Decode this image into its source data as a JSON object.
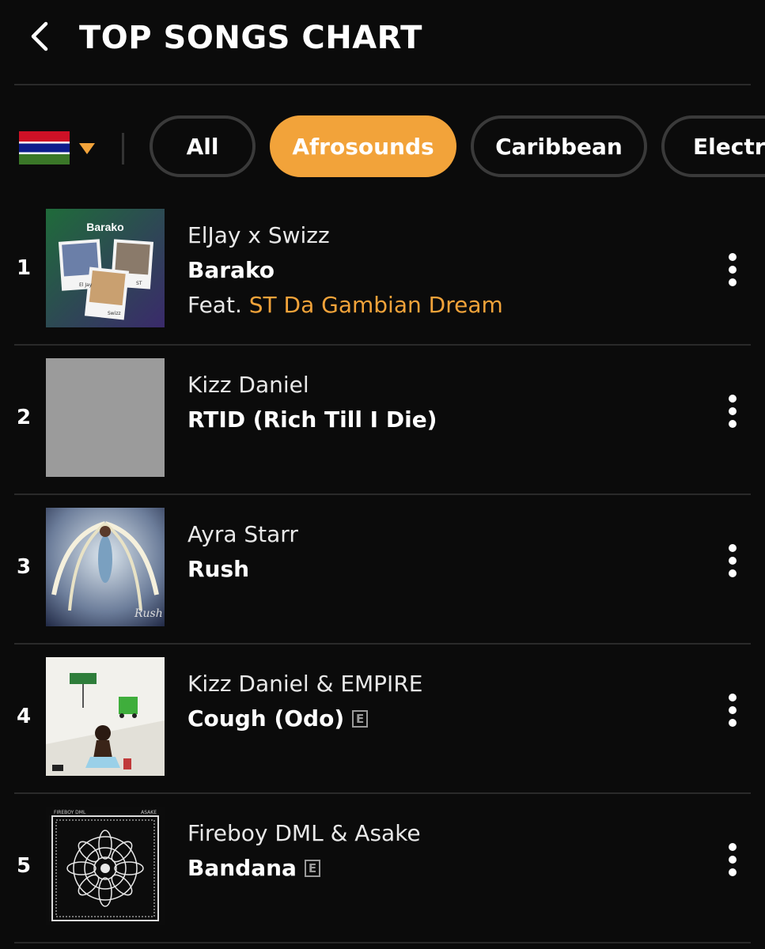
{
  "header": {
    "title": "TOP SONGS CHART",
    "back_icon": "chevron-left-icon"
  },
  "filters": {
    "country_flag": "gambia-flag",
    "dropdown_icon": "caret-down-icon",
    "accent_color": "#f2a33a",
    "chips": [
      {
        "label": "All",
        "active": false
      },
      {
        "label": "Afrosounds",
        "active": true
      },
      {
        "label": "Caribbean",
        "active": false
      },
      {
        "label": "Electro",
        "active": false
      }
    ]
  },
  "songs": [
    {
      "rank": "1",
      "artist": "ElJay x Swizz",
      "title": "Barako",
      "feat_prefix": "Feat.",
      "feat_artist": "ST Da Gambian Dream",
      "explicit": false,
      "cover_text": "Barako",
      "cover_captions": [
        "El Jay",
        "ST",
        "Swizz"
      ]
    },
    {
      "rank": "2",
      "artist": "Kizz Daniel",
      "title": "RTID (Rich Till I Die)",
      "explicit": false
    },
    {
      "rank": "3",
      "artist": "Ayra Starr",
      "title": "Rush",
      "explicit": false,
      "cover_text": "Rush"
    },
    {
      "rank": "4",
      "artist": "Kizz Daniel & EMPIRE",
      "title": "Cough (Odo)",
      "explicit": true,
      "explicit_label": "E"
    },
    {
      "rank": "5",
      "artist": "Fireboy DML & Asake",
      "title": "Bandana",
      "explicit": true,
      "explicit_label": "E",
      "cover_top_left": "FIREBOY DML",
      "cover_top_right": "ASAKE"
    }
  ],
  "row_action_icon": "more-vertical-icon"
}
